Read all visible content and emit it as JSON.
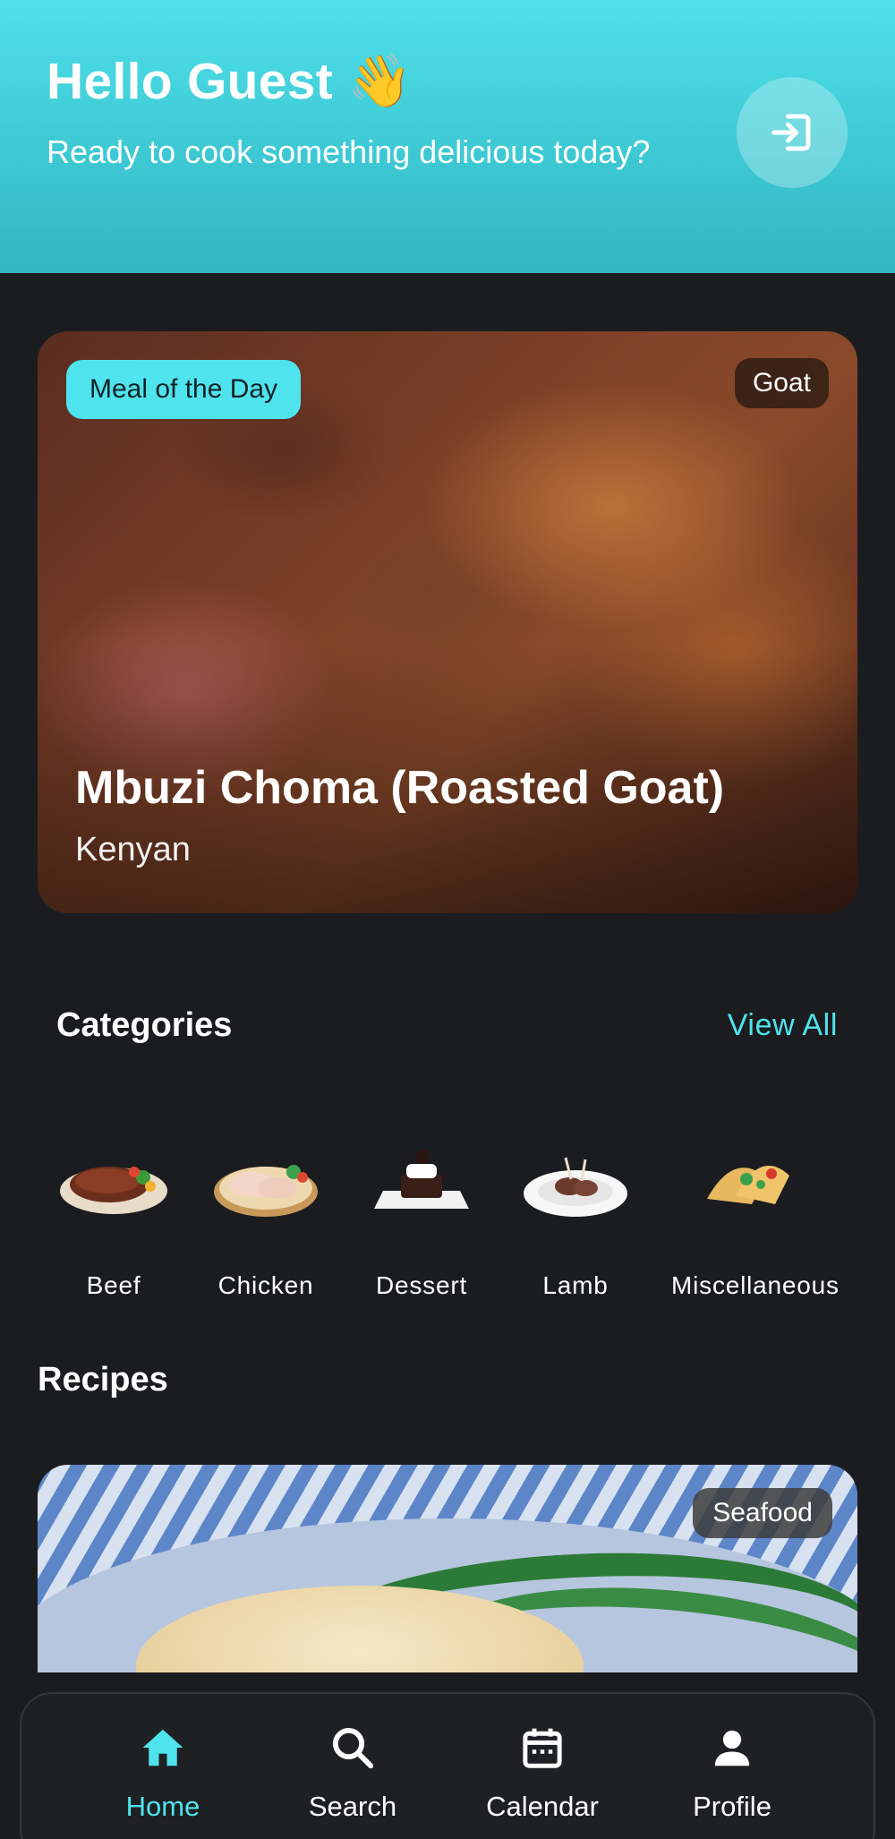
{
  "header": {
    "greeting": "Hello Guest",
    "greeting_emoji": "👋",
    "subtitle": "Ready to cook something delicious today?",
    "logout_icon": "logout-icon"
  },
  "meal_of_day": {
    "badge": "Meal of the Day",
    "category": "Goat",
    "title": "Mbuzi Choma (Roasted Goat)",
    "area": "Kenyan"
  },
  "categories": {
    "title": "Categories",
    "view_all": "View All",
    "items": [
      {
        "label": "Beef"
      },
      {
        "label": "Chicken"
      },
      {
        "label": "Dessert"
      },
      {
        "label": "Lamb"
      },
      {
        "label": "Miscellaneous"
      }
    ]
  },
  "recipes": {
    "title": "Recipes",
    "first_card": {
      "category": "Seafood"
    }
  },
  "bottom_nav": {
    "items": [
      {
        "label": "Home",
        "icon": "home-icon",
        "active": true
      },
      {
        "label": "Search",
        "icon": "search-icon",
        "active": false
      },
      {
        "label": "Calendar",
        "icon": "calendar-icon",
        "active": false
      },
      {
        "label": "Profile",
        "icon": "profile-icon",
        "active": false
      }
    ]
  },
  "colors": {
    "accent": "#4fe3ee",
    "background": "#1b1c1f"
  }
}
